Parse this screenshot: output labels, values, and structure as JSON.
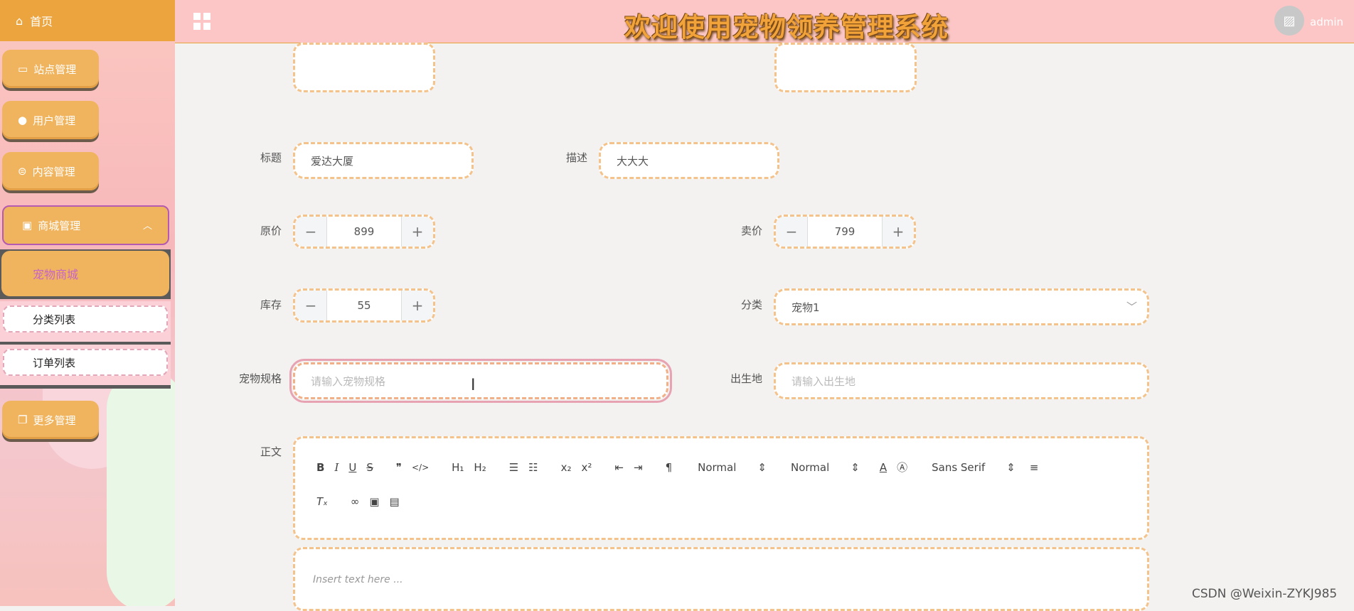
{
  "sidebar": {
    "home_label": "首页",
    "menus": [
      {
        "label": "站点管理"
      },
      {
        "label": "用户管理"
      },
      {
        "label": "内容管理"
      },
      {
        "label": "商城管理"
      },
      {
        "label": "更多管理"
      }
    ],
    "submenu": [
      {
        "label": "宠物商城"
      },
      {
        "label": "分类列表"
      },
      {
        "label": "订单列表"
      }
    ]
  },
  "header": {
    "title": "欢迎使用宠物领养管理系统",
    "username": "admin"
  },
  "form": {
    "title_label": "标题",
    "title_value": "爱达大厦",
    "desc_label": "描述",
    "desc_value": "大大大",
    "orig_price_label": "原价",
    "orig_price_value": "899",
    "sale_price_label": "卖价",
    "sale_price_value": "799",
    "stock_label": "库存",
    "stock_value": "55",
    "category_label": "分类",
    "category_value": "宠物1",
    "spec_label": "宠物规格",
    "spec_placeholder": "请输入宠物规格",
    "origin_label": "出生地",
    "origin_placeholder": "请输入出生地",
    "content_label": "正文",
    "editor": {
      "header_select": "Normal",
      "size_select": "Normal",
      "font_select": "Sans Serif",
      "placeholder": "Insert text here ..."
    }
  },
  "watermark": "CSDN @Weixin-ZYKJ985"
}
